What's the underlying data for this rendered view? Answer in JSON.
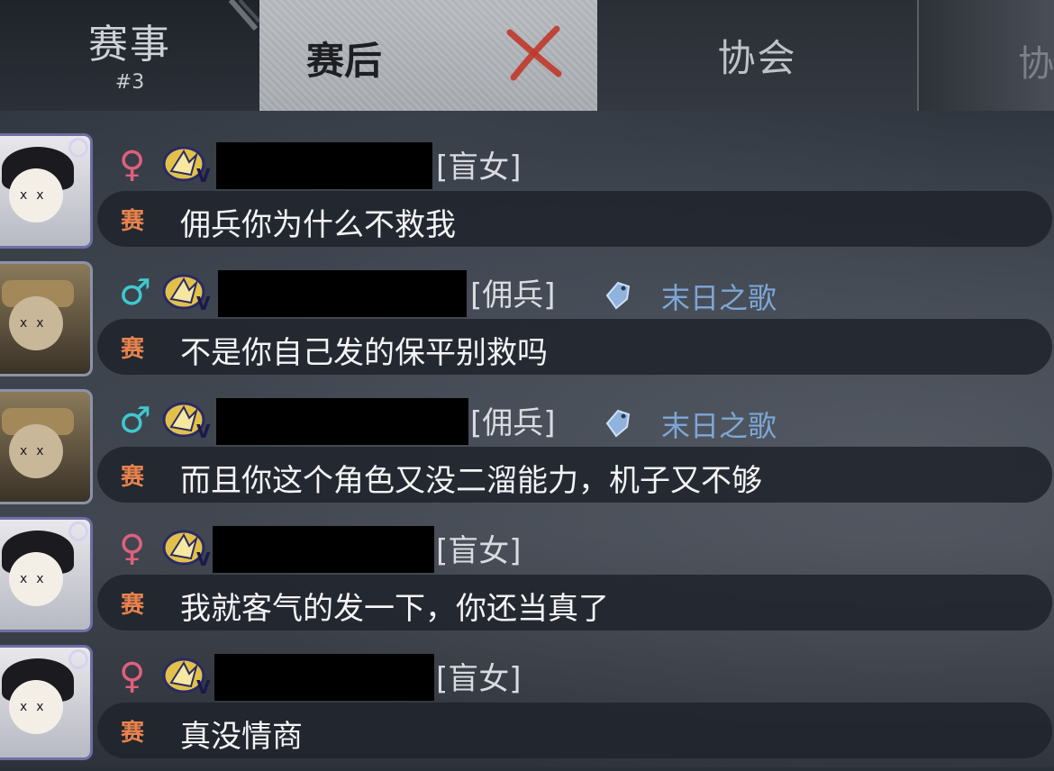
{
  "tabs": {
    "event": {
      "label": "赛事",
      "sub": "#3"
    },
    "after": {
      "label": "赛后"
    },
    "association": {
      "label": "协会"
    },
    "more": {
      "label": "协"
    }
  },
  "messages": [
    {
      "gender": "♀",
      "role": "[盲女]",
      "clan": "",
      "channel": "赛",
      "text": "佣兵你为什么不救我"
    },
    {
      "gender": "♂",
      "role": "[佣兵]",
      "clan": "末日之歌",
      "channel": "赛",
      "text": "不是你自己发的保平别救吗"
    },
    {
      "gender": "♂",
      "role": "[佣兵]",
      "clan": "末日之歌",
      "channel": "赛",
      "text": "而且你这个角色又没二溜能力，机子又不够"
    },
    {
      "gender": "♀",
      "role": "[盲女]",
      "clan": "",
      "channel": "赛",
      "text": "我就客气的发一下，你还当真了"
    },
    {
      "gender": "♀",
      "role": "[盲女]",
      "clan": "",
      "channel": "赛",
      "text": "真没情商"
    }
  ],
  "colors": {
    "female": "#e0607d",
    "male": "#3ec9cf",
    "channel": "#e8834d",
    "clan": "#7da7d6"
  }
}
